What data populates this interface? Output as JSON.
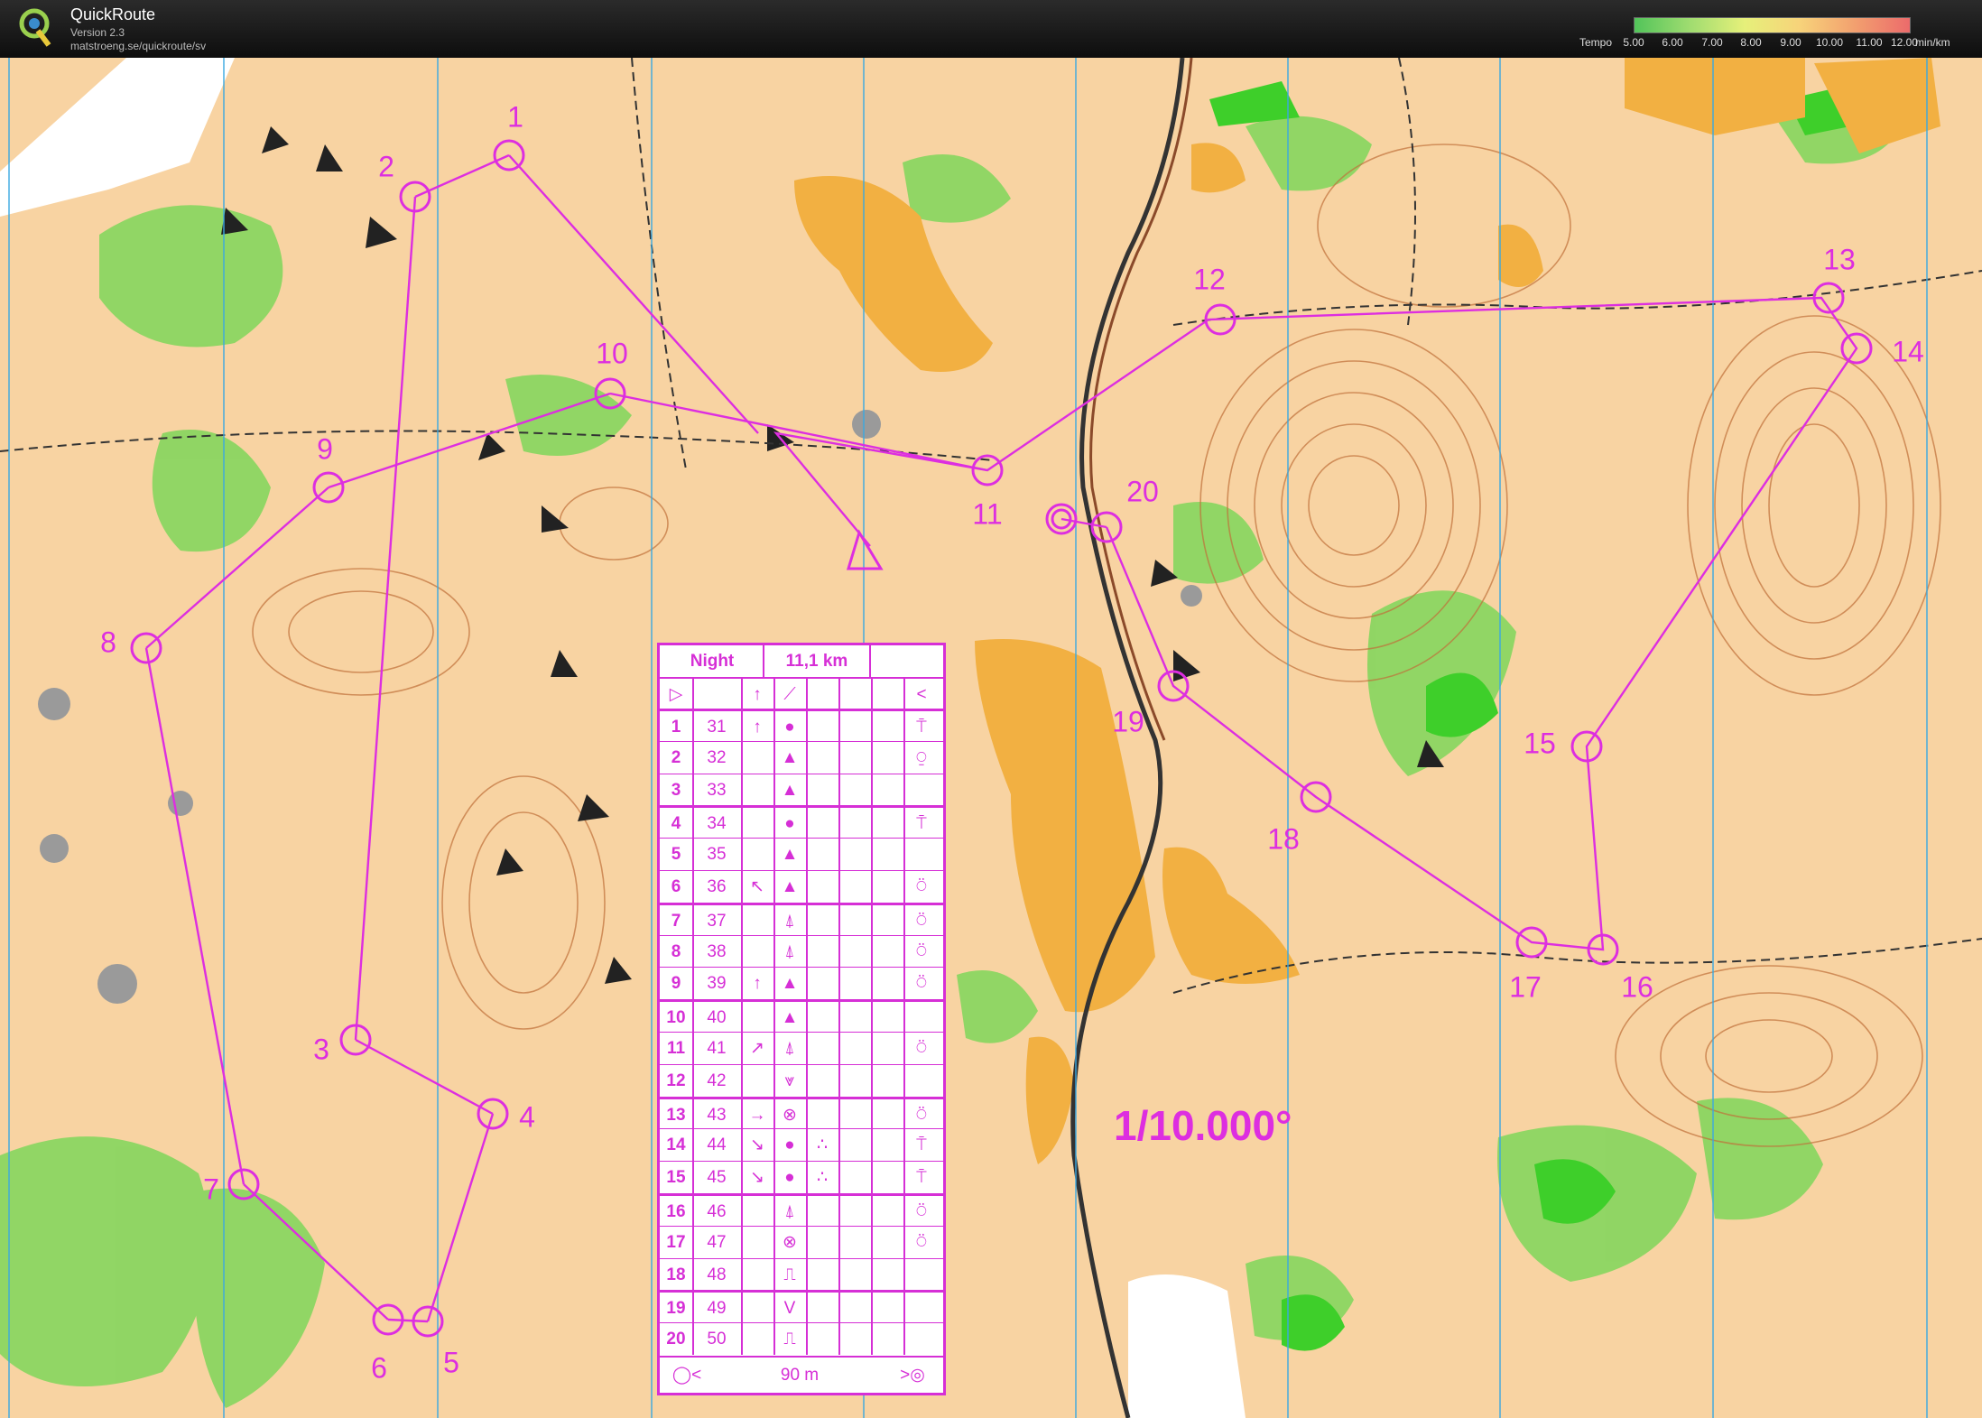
{
  "header": {
    "app_title": "QuickRoute",
    "version": "Version 2.3",
    "url": "matstroeng.se/quickroute/sv",
    "tempo_label": "Tempo",
    "tempo_ticks": [
      "5.00",
      "6.00",
      "7.00",
      "8.00",
      "9.00",
      "10.00",
      "11.00",
      "12.00"
    ],
    "tempo_unit": "min/km"
  },
  "map": {
    "scale_text": "1/10.000°",
    "course_color": "#dd2ee0",
    "controls": [
      "1",
      "2",
      "3",
      "4",
      "5",
      "6",
      "7",
      "8",
      "9",
      "10",
      "11",
      "12",
      "13",
      "14",
      "15",
      "16",
      "17",
      "18",
      "19",
      "20"
    ]
  },
  "legend": {
    "title": "Night",
    "length": "11,1 km",
    "footer": "90 m",
    "rows": [
      {
        "n": "1",
        "code": "31",
        "dir": "↑",
        "feat": "●",
        "where": "",
        "appear": "",
        "dim": "",
        "extra": "⍑"
      },
      {
        "n": "2",
        "code": "32",
        "dir": "",
        "feat": "▲",
        "where": "",
        "appear": "",
        "dim": "",
        "extra": "⍜"
      },
      {
        "n": "3",
        "code": "33",
        "dir": "",
        "feat": "▲",
        "where": "",
        "appear": "",
        "dim": "",
        "extra": ""
      },
      {
        "n": "4",
        "code": "34",
        "dir": "",
        "feat": "●",
        "where": "",
        "appear": "",
        "dim": "",
        "extra": "⍑"
      },
      {
        "n": "5",
        "code": "35",
        "dir": "",
        "feat": "▲",
        "where": "",
        "appear": "",
        "dim": "",
        "extra": ""
      },
      {
        "n": "6",
        "code": "36",
        "dir": "↖",
        "feat": "▲",
        "where": "",
        "appear": "",
        "dim": "",
        "extra": "⍥"
      },
      {
        "n": "7",
        "code": "37",
        "dir": "",
        "feat": "⍋",
        "where": "",
        "appear": "",
        "dim": "",
        "extra": "⍥"
      },
      {
        "n": "8",
        "code": "38",
        "dir": "",
        "feat": "⍋",
        "where": "",
        "appear": "",
        "dim": "",
        "extra": "⍥"
      },
      {
        "n": "9",
        "code": "39",
        "dir": "↑",
        "feat": "▲",
        "where": "",
        "appear": "",
        "dim": "",
        "extra": "⍥"
      },
      {
        "n": "10",
        "code": "40",
        "dir": "",
        "feat": "▲",
        "where": "",
        "appear": "",
        "dim": "",
        "extra": ""
      },
      {
        "n": "11",
        "code": "41",
        "dir": "↗",
        "feat": "⍋",
        "where": "",
        "appear": "",
        "dim": "",
        "extra": "⍥"
      },
      {
        "n": "12",
        "code": "42",
        "dir": "",
        "feat": "⩔",
        "where": "",
        "appear": "",
        "dim": "",
        "extra": ""
      },
      {
        "n": "13",
        "code": "43",
        "dir": "→",
        "feat": "⊗",
        "where": "",
        "appear": "",
        "dim": "",
        "extra": "⍥"
      },
      {
        "n": "14",
        "code": "44",
        "dir": "↘",
        "feat": "●",
        "where": "∴",
        "appear": "",
        "dim": "",
        "extra": "⍑"
      },
      {
        "n": "15",
        "code": "45",
        "dir": "↘",
        "feat": "●",
        "where": "∴",
        "appear": "",
        "dim": "",
        "extra": "⍑"
      },
      {
        "n": "16",
        "code": "46",
        "dir": "",
        "feat": "⍋",
        "where": "",
        "appear": "",
        "dim": "",
        "extra": "⍥"
      },
      {
        "n": "17",
        "code": "47",
        "dir": "",
        "feat": "⊗",
        "where": "",
        "appear": "",
        "dim": "",
        "extra": "⍥"
      },
      {
        "n": "18",
        "code": "48",
        "dir": "",
        "feat": "⎍",
        "where": "",
        "appear": "",
        "dim": "",
        "extra": ""
      },
      {
        "n": "19",
        "code": "49",
        "dir": "",
        "feat": "V",
        "where": "",
        "appear": "",
        "dim": "",
        "extra": ""
      },
      {
        "n": "20",
        "code": "50",
        "dir": "",
        "feat": "⎍",
        "where": "",
        "appear": "",
        "dim": "",
        "extra": ""
      }
    ]
  }
}
